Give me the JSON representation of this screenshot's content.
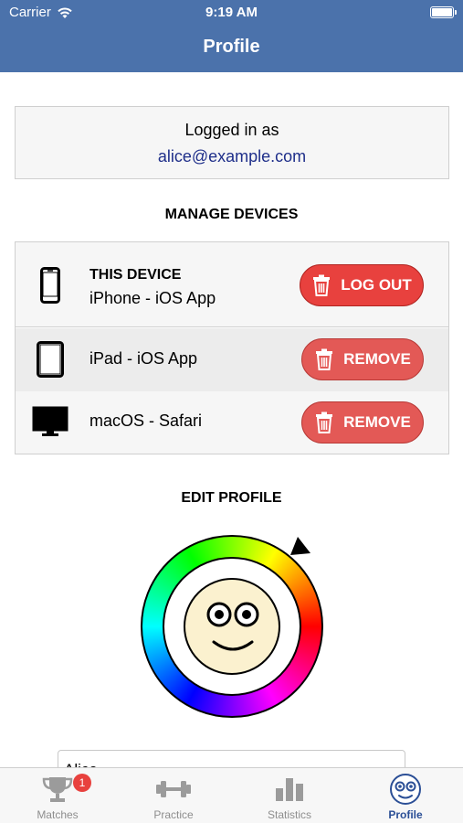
{
  "status_bar": {
    "carrier": "Carrier",
    "time": "9:19 AM",
    "battery_level": 1.0
  },
  "nav": {
    "title": "Profile"
  },
  "login": {
    "label": "Logged in as",
    "email": "alice@example.com"
  },
  "devices": {
    "heading": "MANAGE DEVICES",
    "items": [
      {
        "title": "THIS DEVICE",
        "name": "iPhone - iOS App",
        "icon": "iphone-icon",
        "action": "LOG OUT"
      },
      {
        "name": "iPad - iOS App",
        "icon": "ipad-icon",
        "action": "REMOVE"
      },
      {
        "name": "macOS - Safari",
        "icon": "monitor-icon",
        "action": "REMOVE"
      }
    ]
  },
  "profile": {
    "heading": "EDIT PROFILE",
    "name_value": "Alice"
  },
  "tabs": [
    {
      "label": "Matches",
      "icon": "trophy-icon",
      "badge": "1"
    },
    {
      "label": "Practice",
      "icon": "dumbbell-icon"
    },
    {
      "label": "Statistics",
      "icon": "bar-chart-icon"
    },
    {
      "label": "Profile",
      "icon": "smiley-face-icon",
      "active": true
    }
  ],
  "colors": {
    "header": "#4b72ab",
    "danger": "#e8413e",
    "link": "#1f2f8a",
    "tab_active": "#2b4f96",
    "tab_inactive": "#8e8e8e"
  }
}
